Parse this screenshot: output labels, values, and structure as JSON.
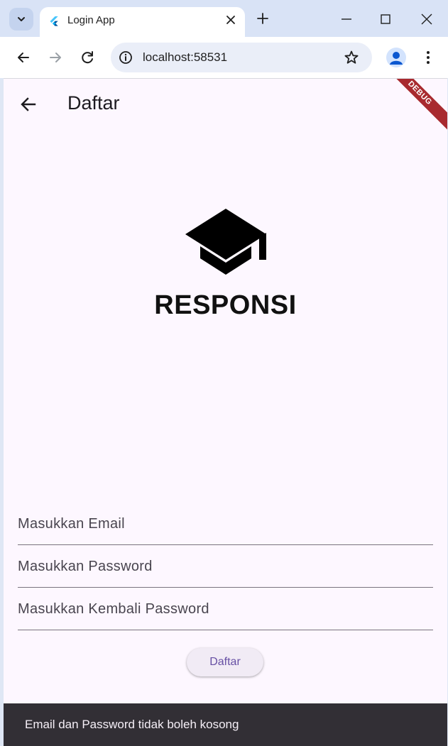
{
  "browser": {
    "tab": {
      "title": "Login App"
    },
    "address_bar": {
      "url": "localhost:58531"
    }
  },
  "app": {
    "appbar": {
      "title": "Daftar"
    },
    "debug_banner": "DEBUG",
    "brand": {
      "title": "RESPONSI",
      "icon": "school-icon"
    },
    "form": {
      "email_placeholder": "Masukkan Email",
      "password_placeholder": "Masukkan Password",
      "confirm_password_placeholder": "Masukkan Kembali Password",
      "submit_label": "Daftar"
    },
    "snackbar": {
      "message": "Email dan Password tidak boleh kosong"
    }
  },
  "colors": {
    "page_background": "#fdf7ff",
    "button_text": "#6750a4",
    "snackbar_background": "#322f35",
    "debug_ribbon": "#a82a2f"
  }
}
